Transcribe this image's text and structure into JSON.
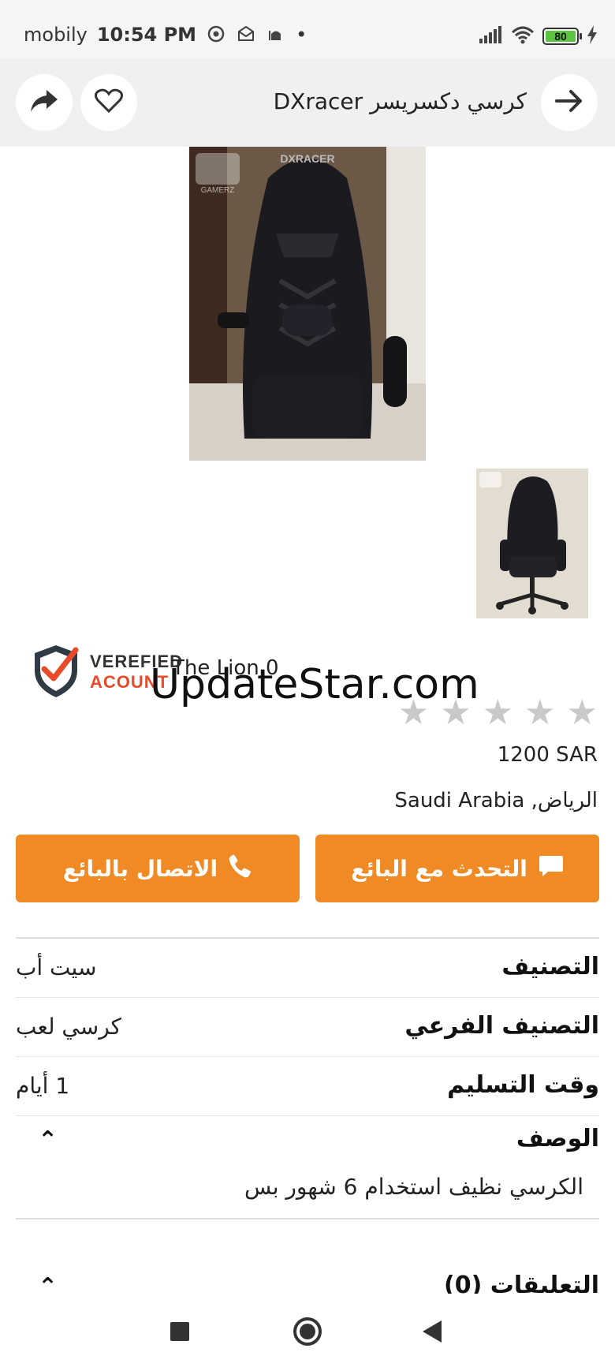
{
  "status_bar": {
    "carrier": "mobily",
    "time": "10:54 PM",
    "battery": "80",
    "dot": "•"
  },
  "header": {
    "title": "كرسي دكسريسر DXracer",
    "share_icon": "share-icon",
    "favorite_icon": "heart-icon",
    "back_icon": "arrow-right-icon"
  },
  "gallery": {
    "main_logo": "DXRACER",
    "overlay_text": "GAMERZ"
  },
  "seller": {
    "badge_line1": "VEREFIED",
    "badge_line2": "ACOUNT",
    "name": "The Lion 0",
    "rating": 0,
    "stars": [
      "★",
      "★",
      "★",
      "★",
      "★"
    ]
  },
  "watermark": "UpdateStar.com",
  "listing": {
    "price": "1200 SAR",
    "location": "الرياض, Saudi Arabia"
  },
  "actions": {
    "chat_label": "التحدث مع البائع",
    "call_label": "الاتصال بالبائع"
  },
  "details": [
    {
      "label": "التصنيف",
      "value": "سيت أب"
    },
    {
      "label": "التصنيف الفرعي",
      "value": "كرسي لعب"
    },
    {
      "label": "وقت التسليم",
      "value": "1 أيام"
    }
  ],
  "description": {
    "title": "الوصف",
    "text": "الكرسي نظيف استخدام 6 شهور بس",
    "chevron": "⌃"
  },
  "comments": {
    "title": "التعليقات (0)",
    "chevron": "⌃"
  }
}
